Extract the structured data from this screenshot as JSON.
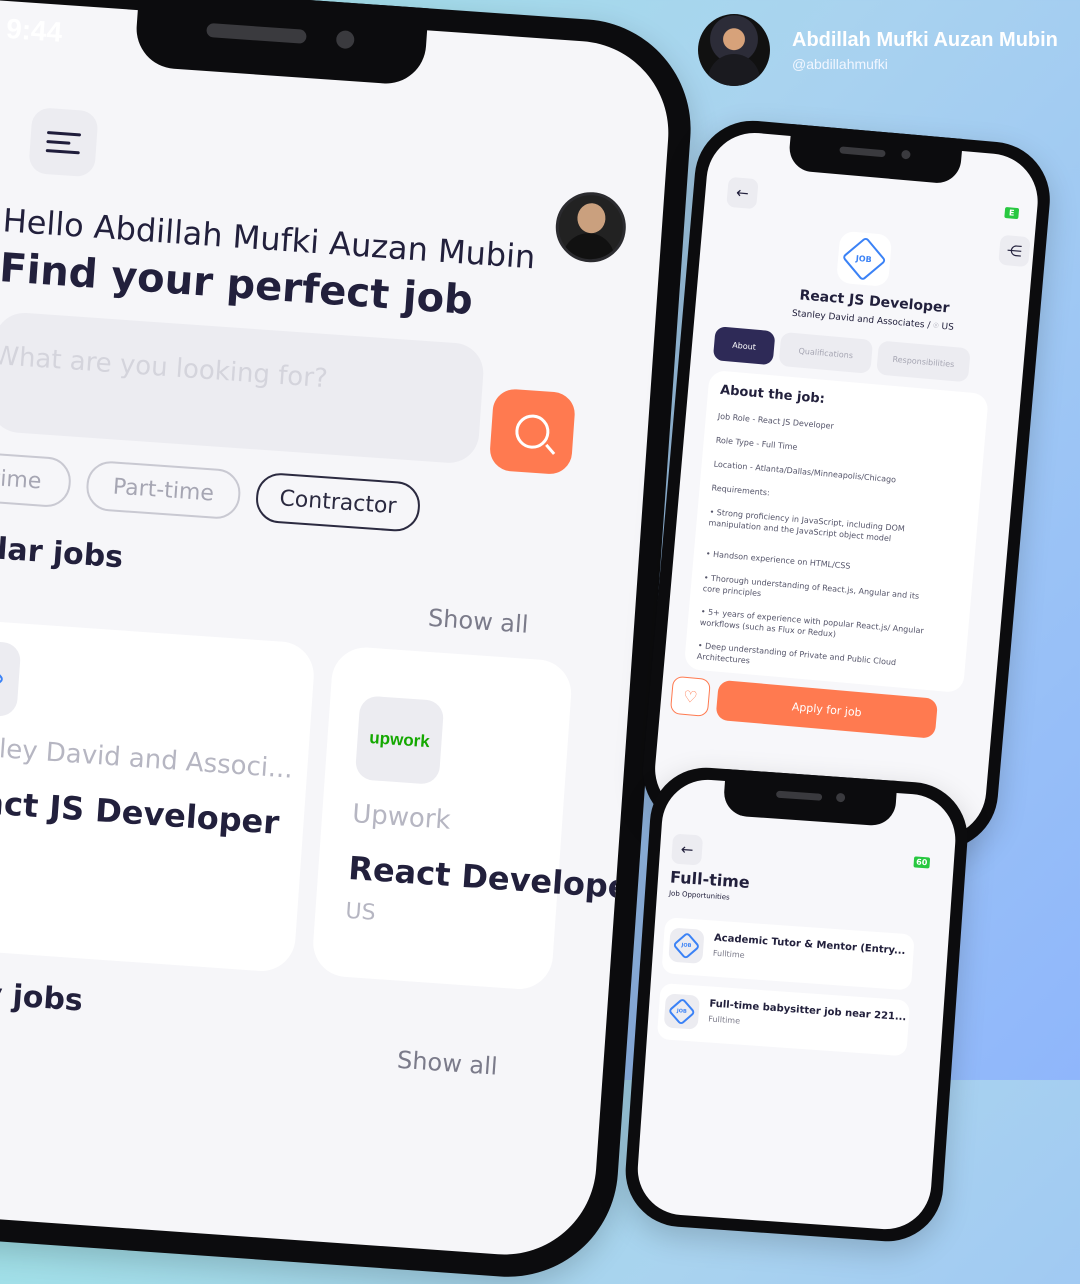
{
  "author": {
    "name": "Abdillah Mufki Auzan Mubin",
    "handle": "@abdillahmufki"
  },
  "home": {
    "status_time": "9:44",
    "greeting": "Hello Abdillah Mufki Auzan Mubin",
    "headline": "Find your perfect job",
    "search_placeholder": "What are you looking for?",
    "chips": [
      "Full-time",
      "Part-time",
      "Contractor"
    ],
    "popular_title": "Popular jobs",
    "show_all": "Show all",
    "cards": [
      {
        "company": "Stanley David and Associ...",
        "title": "React JS Developer",
        "logo": "JOB"
      },
      {
        "company": "Upwork",
        "title": "React Developer",
        "location": "US",
        "logo": "upwork"
      }
    ],
    "nearby_title": "Nearby jobs",
    "show_all_2": "Show all"
  },
  "detail": {
    "title": "React JS Developer",
    "company": "Stanley David and Associates /",
    "location": "US",
    "tabs": [
      "About",
      "Qualifications",
      "Responsibilities"
    ],
    "about_heading": "About the job:",
    "lines": [
      "Job Role - React JS Developer",
      "Role Type - Full Time",
      "Location - Atlanta/Dallas/Minneapolis/Chicago",
      "Requirements:",
      "• Strong proficiency in JavaScript, including DOM manipulation and the JavaScript object model",
      "• Handson experience on HTML/CSS",
      "• Thorough understanding of React.js, Angular and its core principles",
      "• 5+ years of experience with popular React.js/ Angular workflows (such as Flux or Redux)",
      "• Deep understanding of Private and Public Cloud Architectures"
    ],
    "apply_label": "Apply for job",
    "battery": "E"
  },
  "list": {
    "title": "Full-time",
    "subtitle": "Job Opportunities",
    "battery": "60",
    "items": [
      {
        "title": "Academic Tutor & Mentor (Entry...",
        "type": "Fulltime"
      },
      {
        "title": "Full-time babysitter job near 221...",
        "type": "Fulltime"
      }
    ]
  },
  "colors": {
    "accent": "#ff7a50",
    "navy": "#2e2a57",
    "upwork_green": "#14a800"
  },
  "icons": [
    "menu-icon",
    "search-icon",
    "back-arrow-icon",
    "share-icon",
    "heart-icon",
    "location-pin-icon",
    "job-logo-icon"
  ]
}
